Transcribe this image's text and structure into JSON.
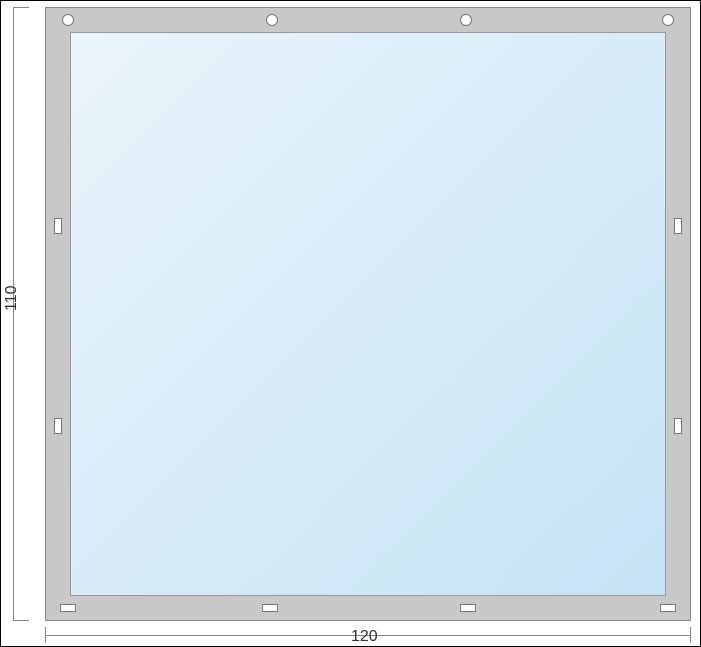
{
  "dimensions": {
    "width_label": "120",
    "height_label": "110"
  }
}
